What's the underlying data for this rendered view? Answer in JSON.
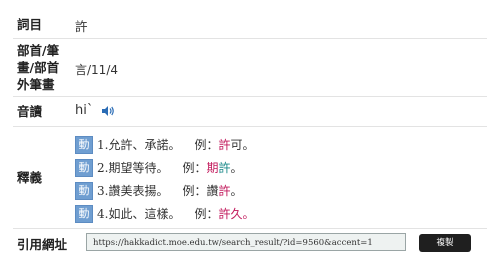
{
  "entry": {
    "headword_label": "詞目",
    "headword": "許",
    "radical_label": "部首/筆畫/部首外筆畫",
    "radical_value": "言/11/4",
    "pronunciation_label": "音讀",
    "pronunciation": "hi`",
    "speaker_icon": "speaker-icon",
    "definitions_label": "釋義",
    "definitions": [
      {
        "pos": "動",
        "text": "1.允許、承諾。",
        "ex_label": "例：",
        "ex_hl": "許",
        "ex_rest": "可。",
        "ex_hl_color": "#c2185b"
      },
      {
        "pos": "動",
        "text": "2.期望等待。",
        "ex_label": "例：",
        "ex_pre": "期",
        "ex_hl": "許",
        "ex_rest": "。",
        "ex_hl_color": "#1b8a8a"
      },
      {
        "pos": "動",
        "text": "3.讚美表揚。",
        "ex_label": "例：",
        "ex_pre": "讚",
        "ex_hl": "許",
        "ex_rest": "。",
        "ex_hl_color": "#c2185b"
      },
      {
        "pos": "動",
        "text": "4.如此、這樣。",
        "ex_label": "例：",
        "ex_hl": "許",
        "ex_rest": "久。",
        "ex_hl_color": "#c2185b"
      }
    ],
    "citation_label": "引用網址",
    "citation_url": "https://hakkadict.moe.edu.tw/search_result/?id=9560&accent=1",
    "copy_label": "複製"
  },
  "colors": {
    "pos_badge": "#6f9ed1",
    "highlight_red": "#c2185b",
    "highlight_teal": "#1b8a8a",
    "copy_button": "#1f1f1f"
  }
}
